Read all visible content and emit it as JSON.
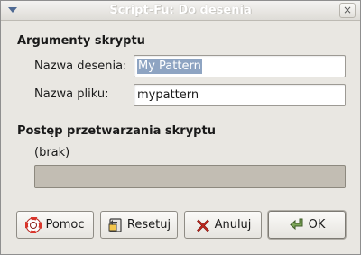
{
  "window": {
    "title": "Script-Fu: Do desenia",
    "close_glyph": "×"
  },
  "section_args": {
    "title": "Argumenty skryptu"
  },
  "fields": {
    "pattern_name": {
      "label": "Nazwa desenia:",
      "value": "My Pattern"
    },
    "file_name": {
      "label": "Nazwa pliku:",
      "value": "mypattern"
    }
  },
  "section_progress": {
    "title": "Postęp przetwarzania skryptu",
    "status": "(brak)"
  },
  "buttons": {
    "help": {
      "label": "Pomoc",
      "icon": "lifebuoy-icon"
    },
    "reset": {
      "label": "Resetuj",
      "icon": "reset-icon"
    },
    "cancel": {
      "label": "Anuluj",
      "icon": "cancel-x-icon"
    },
    "ok": {
      "label": "OK",
      "icon": "ok-arrow-icon"
    }
  },
  "colors": {
    "window_bg": "#e9e7e2",
    "selection": "#8ea4c2",
    "progress_trough": "#c2bdb3"
  }
}
